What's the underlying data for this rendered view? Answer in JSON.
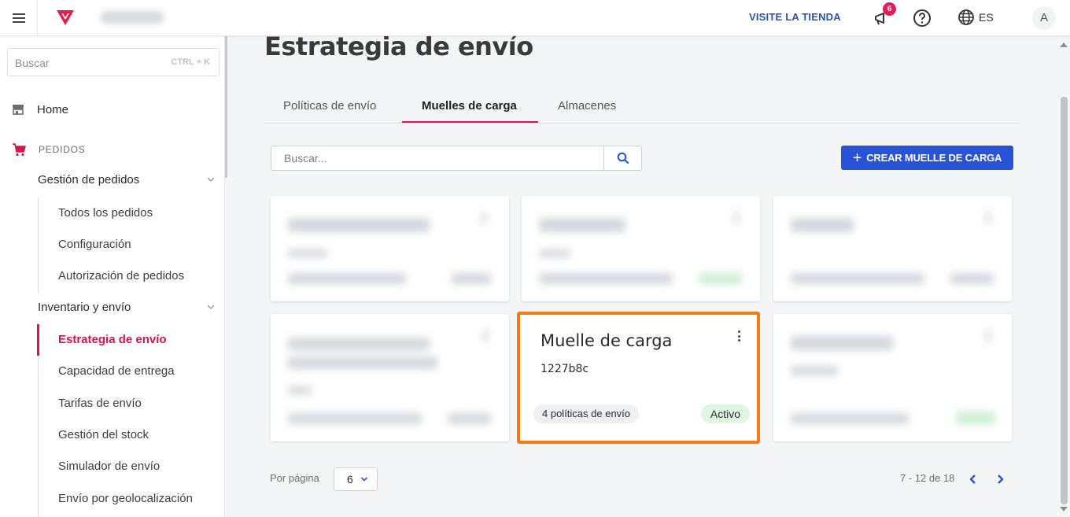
{
  "header": {
    "visit_store": "VISITE LA TIENDA",
    "notification_count": "6",
    "language": "ES",
    "avatar_initial": "A",
    "brand_color": "#e11d48",
    "accent_color": "#2953d6"
  },
  "sidebar": {
    "search_placeholder": "Buscar",
    "search_shortcut": "CTRL + K",
    "home_label": "Home",
    "section_label": "PEDIDOS",
    "groups": [
      {
        "label": "Gestión de pedidos",
        "items": [
          "Todos los pedidos",
          "Configuración",
          "Autorización de pedidos"
        ]
      },
      {
        "label": "Inventario y envío",
        "items": [
          "Estrategia de envío",
          "Capacidad de entrega",
          "Tarifas de envío",
          "Gestión del stock",
          "Simulador de envío",
          "Envío por geolocalización"
        ]
      }
    ],
    "active_item": "Estrategia de envío"
  },
  "main": {
    "title": "Estrategia de envío",
    "tabs": [
      {
        "label": "Políticas de envío"
      },
      {
        "label": "Muelles de carga"
      },
      {
        "label": "Almacenes"
      }
    ],
    "active_tab": "Muelles de carga",
    "search_placeholder": "Buscar...",
    "create_button": "CREAR MUELLE DE CARGA",
    "focused_card": {
      "title": "Muelle de carga",
      "id": "1227b8c",
      "policies": "4 políticas de envío",
      "status": "Activo"
    },
    "pagination": {
      "per_page_label": "Por página",
      "per_page_value": "6",
      "range": "7 - 12 de 18"
    }
  }
}
